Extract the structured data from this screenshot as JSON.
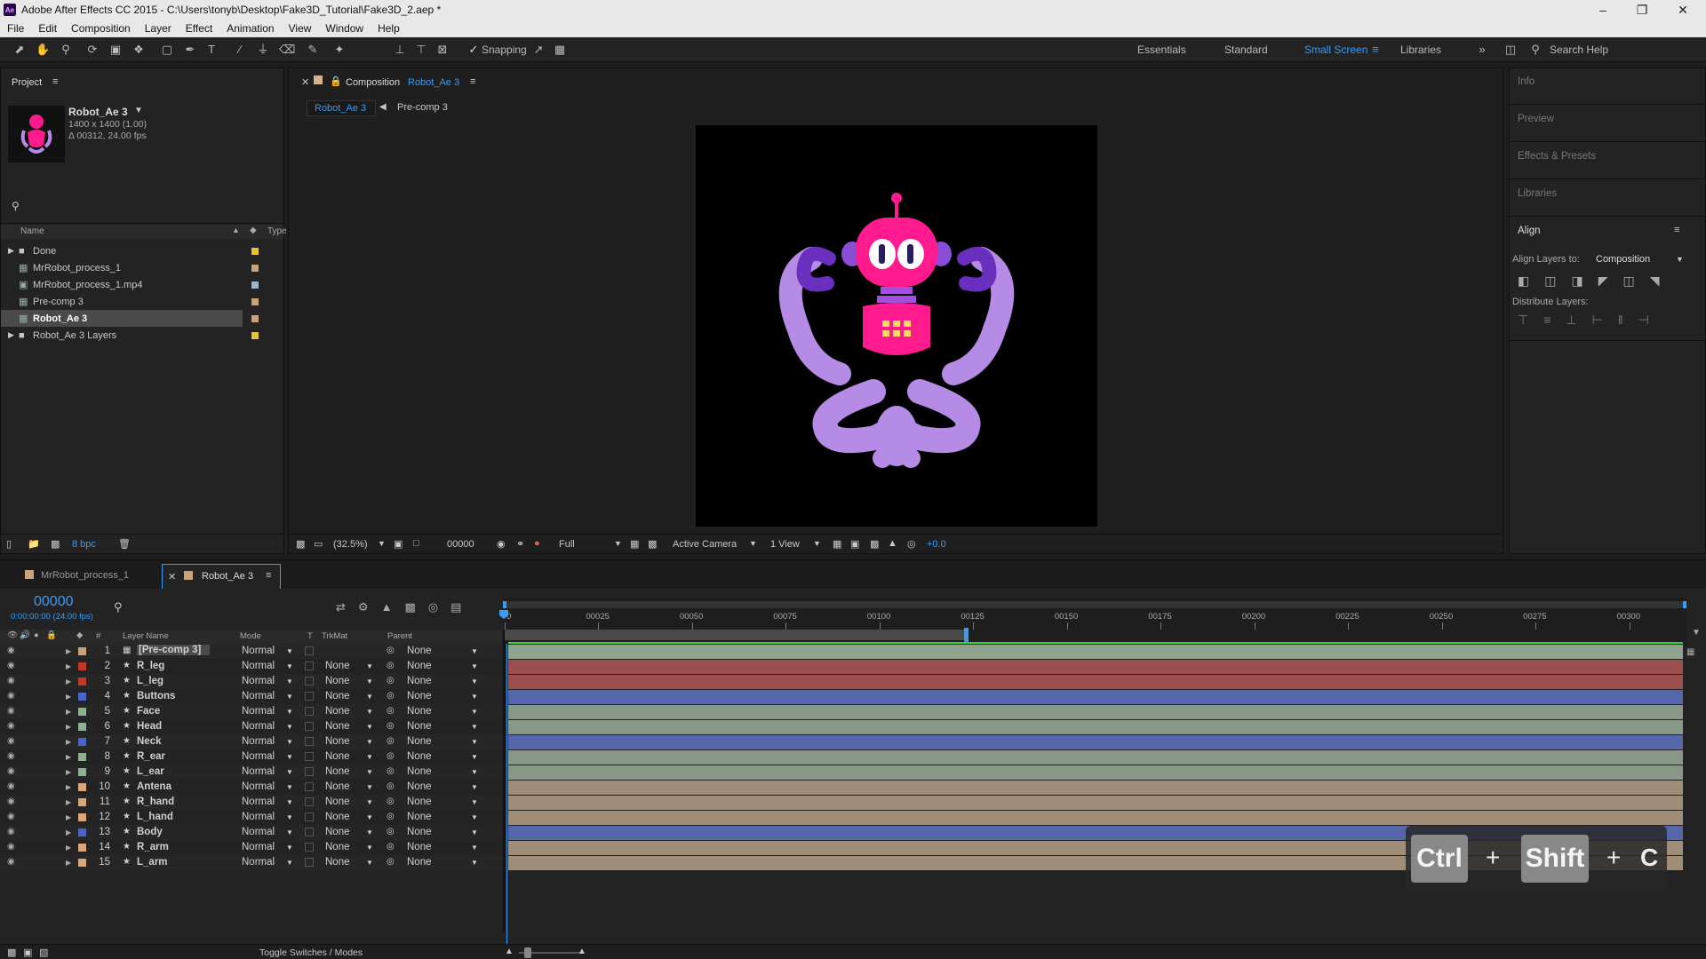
{
  "window": {
    "title": "Adobe After Effects CC 2015 - C:\\Users\\tonyb\\Desktop\\Fake3D_Tutorial\\Fake3D_2.aep *",
    "app_icon": "Ae"
  },
  "menu": [
    "File",
    "Edit",
    "Composition",
    "Layer",
    "Effect",
    "Animation",
    "View",
    "Window",
    "Help"
  ],
  "toolbar": {
    "snapping_label": "Snapping",
    "workspaces": [
      "Essentials",
      "Standard",
      "Small Screen",
      "Libraries"
    ],
    "active_workspace": "Small Screen",
    "search_label": "Search Help"
  },
  "project": {
    "panel_title": "Project",
    "item_name": "Robot_Ae 3",
    "item_dims": "1400 x 1400 (1.00)",
    "item_duration": "Δ 00312, 24.00 fps",
    "column_name": "Name",
    "column_type": "Type",
    "items": [
      {
        "name": "Done",
        "kind": "folder",
        "color": "#e6c23a"
      },
      {
        "name": "MrRobot_process_1",
        "kind": "comp",
        "color": "#c9a27a"
      },
      {
        "name": "MrRobot_process_1.mp4",
        "kind": "footage",
        "color": "#9fb6c9"
      },
      {
        "name": "Pre-comp 3",
        "kind": "comp",
        "color": "#c9a27a"
      },
      {
        "name": "Robot_Ae 3",
        "kind": "comp",
        "color": "#c9a27a",
        "selected": true
      },
      {
        "name": "Robot_Ae 3 Layers",
        "kind": "folder",
        "color": "#e6c23a"
      }
    ],
    "bpc": "8 bpc"
  },
  "composition": {
    "panel_prefix": "Composition",
    "panel_name": "Robot_Ae 3",
    "breadcrumb": [
      "Robot_Ae 3",
      "Pre-comp 3"
    ],
    "zoom": "(32.5%)",
    "frame": "00000",
    "resolution": "Full",
    "camera": "Active Camera",
    "views": "1 View",
    "exposure": "+0.0"
  },
  "right_panel": {
    "items": [
      "Info",
      "Preview",
      "Effects & Presets",
      "Libraries"
    ],
    "align_title": "Align",
    "align_layers_to": "Align Layers to:",
    "align_target": "Composition",
    "distribute_layers": "Distribute Layers:"
  },
  "timeline": {
    "tabs": [
      "MrRobot_process_1",
      "Robot_Ae 3"
    ],
    "active_tab": "Robot_Ae 3",
    "current_frame": "00000",
    "timecode": "0:00:00:00 (24.00 fps)",
    "headers": {
      "layer_name": "Layer Name",
      "mode": "Mode",
      "t": "T",
      "trkmat": "TrkMat",
      "parent": "Parent",
      "num": "#"
    },
    "ruler": [
      "0",
      "00025",
      "00050",
      "00075",
      "00100",
      "00125",
      "00150",
      "00175",
      "00200",
      "00225",
      "00250",
      "00275",
      "00300"
    ],
    "work_area_end_fraction": 0.39,
    "layers": [
      {
        "num": "1",
        "name": "[Pre-comp 3]",
        "mode": "Normal",
        "trkmat": "",
        "parent": "None",
        "color": "#c9a27a",
        "bar": "#8fa38f",
        "precomp": true
      },
      {
        "num": "2",
        "name": "R_leg",
        "mode": "Normal",
        "trkmat": "None",
        "parent": "None",
        "color": "#c0392b",
        "bar": "#9b4f4f"
      },
      {
        "num": "3",
        "name": "L_leg",
        "mode": "Normal",
        "trkmat": "None",
        "parent": "None",
        "color": "#c0392b",
        "bar": "#9b4f4f"
      },
      {
        "num": "4",
        "name": "Buttons",
        "mode": "Normal",
        "trkmat": "None",
        "parent": "None",
        "color": "#4a64c9",
        "bar": "#5566aa"
      },
      {
        "num": "5",
        "name": "Face",
        "mode": "Normal",
        "trkmat": "None",
        "parent": "None",
        "color": "#8fb08f",
        "bar": "#879887"
      },
      {
        "num": "6",
        "name": "Head",
        "mode": "Normal",
        "trkmat": "None",
        "parent": "None",
        "color": "#8fb08f",
        "bar": "#879887"
      },
      {
        "num": "7",
        "name": "Neck",
        "mode": "Normal",
        "trkmat": "None",
        "parent": "None",
        "color": "#4a64c9",
        "bar": "#5566aa"
      },
      {
        "num": "8",
        "name": "R_ear",
        "mode": "Normal",
        "trkmat": "None",
        "parent": "None",
        "color": "#8fb08f",
        "bar": "#879887"
      },
      {
        "num": "9",
        "name": "L_ear",
        "mode": "Normal",
        "trkmat": "None",
        "parent": "None",
        "color": "#8fb08f",
        "bar": "#879887"
      },
      {
        "num": "10",
        "name": "Antena",
        "mode": "Normal",
        "trkmat": "None",
        "parent": "None",
        "color": "#d9a77a",
        "bar": "#a08d78"
      },
      {
        "num": "11",
        "name": "R_hand",
        "mode": "Normal",
        "trkmat": "None",
        "parent": "None",
        "color": "#d9a77a",
        "bar": "#a08d78"
      },
      {
        "num": "12",
        "name": "L_hand",
        "mode": "Normal",
        "trkmat": "None",
        "parent": "None",
        "color": "#d9a77a",
        "bar": "#a08d78"
      },
      {
        "num": "13",
        "name": "Body",
        "mode": "Normal",
        "trkmat": "None",
        "parent": "None",
        "color": "#4a64c9",
        "bar": "#5566aa"
      },
      {
        "num": "14",
        "name": "R_arm",
        "mode": "Normal",
        "trkmat": "None",
        "parent": "None",
        "color": "#d9a77a",
        "bar": "#a08d78"
      },
      {
        "num": "15",
        "name": "L_arm",
        "mode": "Normal",
        "trkmat": "None",
        "parent": "None",
        "color": "#d9a77a",
        "bar": "#a08d78"
      }
    ],
    "toggle_label": "Toggle Switches / Modes"
  },
  "shortcut_overlay": {
    "key1": "Ctrl",
    "plus1": "+",
    "key2": "Shift",
    "plus2": "+",
    "key3": "C"
  }
}
